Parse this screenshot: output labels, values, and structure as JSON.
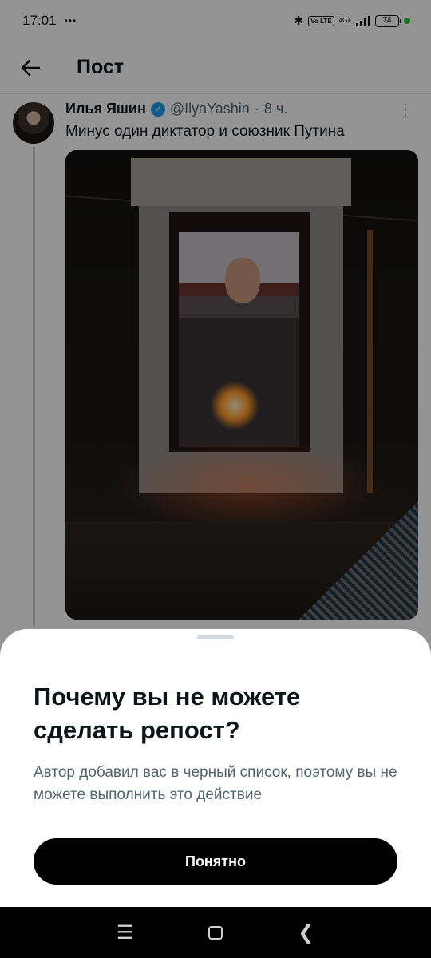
{
  "status_bar": {
    "time": "17:01",
    "notification_icons": "•••",
    "volte_badge": "Vo LTE",
    "network": "4G+",
    "battery": "74"
  },
  "header": {
    "title": "Пост",
    "back_icon": "arrow-left-icon"
  },
  "tweet": {
    "author_name": "Илья Яшин",
    "handle": "@IlyaYashin",
    "separator": "·",
    "time": "8 ч.",
    "text": "Минус один диктатор и союзник Путина",
    "verified_icon": "verified-badge-icon",
    "more_icon": "more-vertical-icon"
  },
  "sheet": {
    "title": "Почему вы не можете сделать репост?",
    "text": "Автор добавил вас в черный список, поэтому вы не можете выполнить это действие",
    "button_label": "Понятно"
  },
  "colors": {
    "accent": "#1d9bf0",
    "button": "#000000",
    "text_primary": "#0f1419",
    "text_secondary": "#536471"
  }
}
